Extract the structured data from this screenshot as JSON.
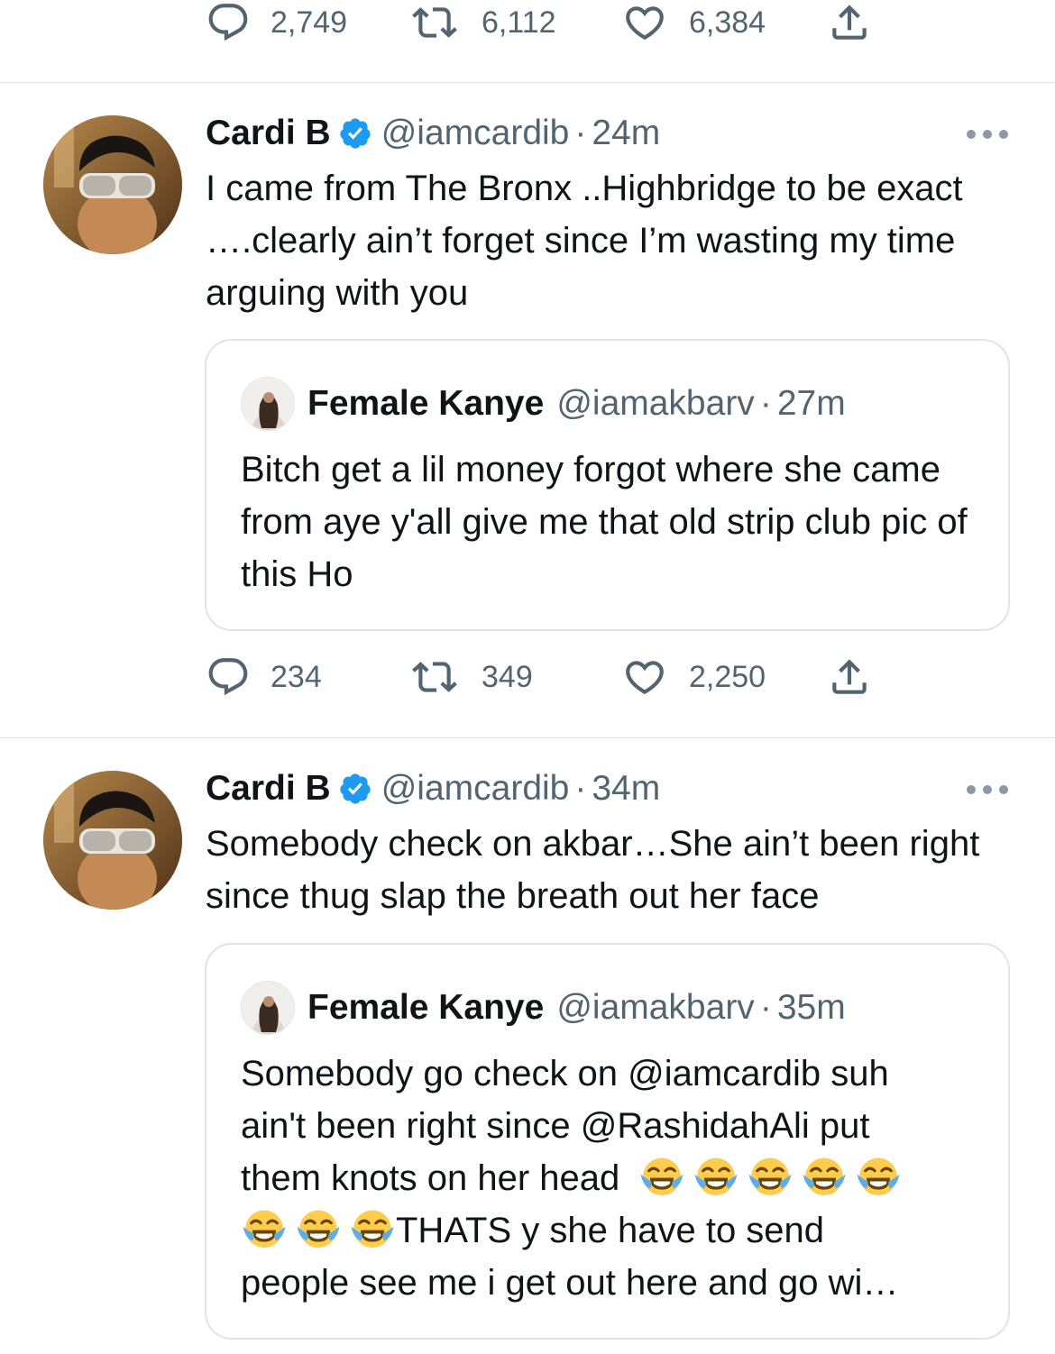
{
  "top_actions": {
    "replies": "2,749",
    "retweets": "6,112",
    "likes": "6,384"
  },
  "tweets": [
    {
      "name": "Cardi B",
      "handle": "@iamcardib",
      "separator": "·",
      "time": "24m",
      "text": "I came from The Bronx ..Highbridge to be exact ….clearly ain’t forget since I’m wasting my time arguing with you",
      "quote": {
        "name": "Female Kanye",
        "handle": "@iamakbarv",
        "separator": "·",
        "time": "27m",
        "text": "Bitch get a lil money forgot where she came from aye y'all give me that old strip club pic of this Ho"
      },
      "actions": {
        "replies": "234",
        "retweets": "349",
        "likes": "2,250"
      }
    },
    {
      "name": "Cardi B",
      "handle": "@iamcardib",
      "separator": "·",
      "time": "34m",
      "text": "Somebody check on akbar…She ain’t been right since thug slap the breath out her face",
      "quote": {
        "name": "Female Kanye",
        "handle": "@iamakbarv",
        "separator": "·",
        "time": "35m",
        "text_line1": "Somebody go check on @iamcardib suh",
        "text_line2": "ain't been right since @RashidahAli put",
        "text_line3": "them knots on her head",
        "text_line4": "THATS y she have to send",
        "text_line5": "people see me i get out here and go wi…",
        "emoji": "face-with-tears-of-joy"
      }
    }
  ],
  "colors": {
    "text": "#0f1419",
    "secondary": "#536471",
    "verified": "#1d9bf0",
    "border": "#e1e4e7"
  }
}
